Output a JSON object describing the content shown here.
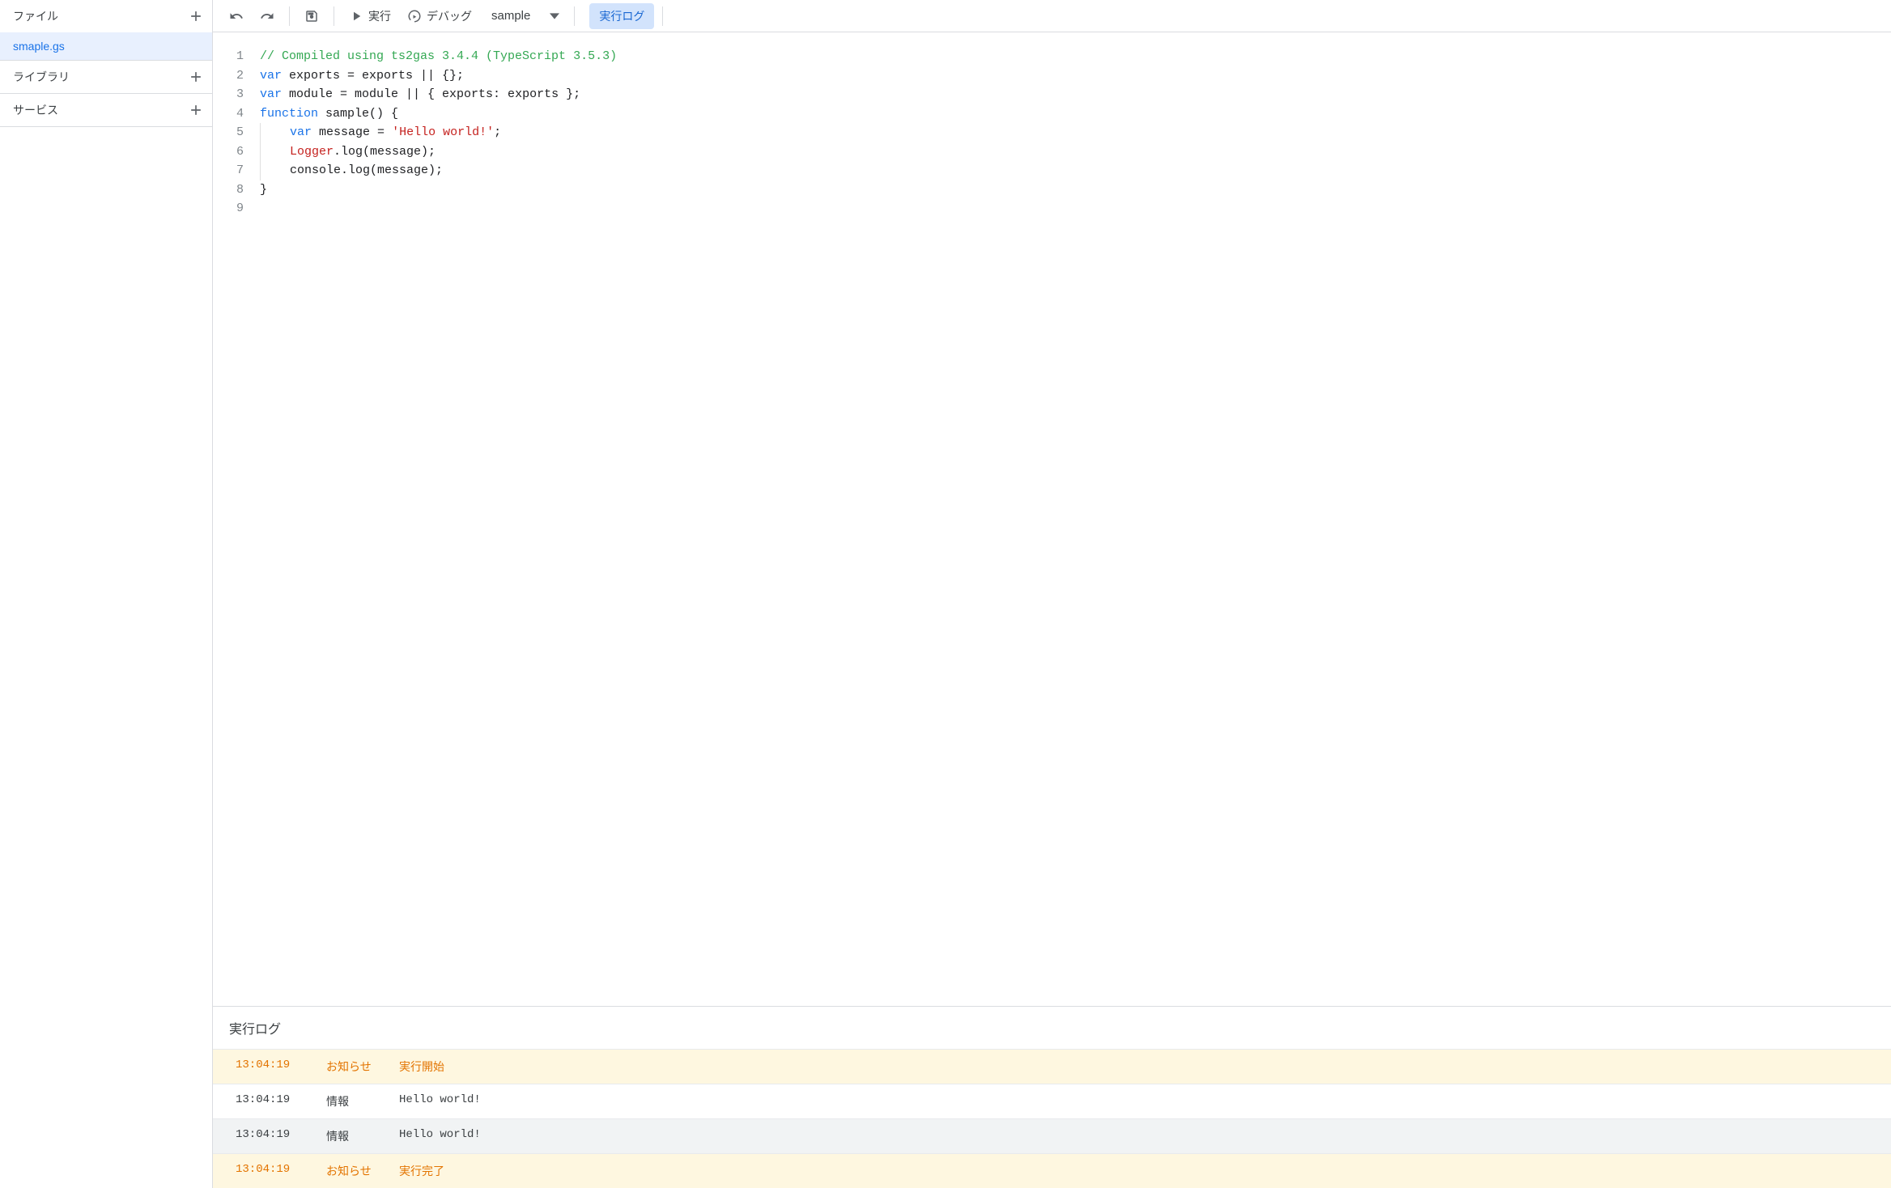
{
  "sidebar": {
    "files_label": "ファイル",
    "libraries_label": "ライブラリ",
    "services_label": "サービス",
    "file_items": [
      {
        "name": "smaple.gs"
      }
    ]
  },
  "toolbar": {
    "run_label": "実行",
    "debug_label": "デバッグ",
    "function_selected": "sample",
    "exec_log_label": "実行ログ"
  },
  "code": {
    "lines": [
      {
        "n": 1,
        "indent": 0,
        "tokens": [
          [
            "comment",
            "// Compiled using ts2gas 3.4.4 (TypeScript 3.5.3)"
          ]
        ]
      },
      {
        "n": 2,
        "indent": 0,
        "tokens": [
          [
            "keyword",
            "var"
          ],
          [
            "default",
            " exports = exports || {};"
          ]
        ]
      },
      {
        "n": 3,
        "indent": 0,
        "tokens": [
          [
            "keyword",
            "var"
          ],
          [
            "default",
            " module = module || { exports: exports };"
          ]
        ]
      },
      {
        "n": 4,
        "indent": 0,
        "tokens": [
          [
            "keyword",
            "function"
          ],
          [
            "default",
            " sample() {"
          ]
        ]
      },
      {
        "n": 5,
        "indent": 1,
        "tokens": [
          [
            "keyword",
            "var"
          ],
          [
            "default",
            " message = "
          ],
          [
            "string",
            "'Hello world!'"
          ],
          [
            "default",
            ";"
          ]
        ]
      },
      {
        "n": 6,
        "indent": 1,
        "tokens": [
          [
            "class",
            "Logger"
          ],
          [
            "default",
            ".log(message);"
          ]
        ]
      },
      {
        "n": 7,
        "indent": 1,
        "tokens": [
          [
            "default",
            "console.log(message);"
          ]
        ]
      },
      {
        "n": 8,
        "indent": 0,
        "tokens": [
          [
            "default",
            "}"
          ]
        ]
      },
      {
        "n": 9,
        "indent": 0,
        "tokens": []
      }
    ]
  },
  "log": {
    "title": "実行ログ",
    "rows": [
      {
        "time": "13:04:19",
        "type": "お知らせ",
        "msg": "実行開始",
        "style": "notice"
      },
      {
        "time": "13:04:19",
        "type": "情報",
        "msg": "Hello world!",
        "style": "normal"
      },
      {
        "time": "13:04:19",
        "type": "情報",
        "msg": "Hello world!",
        "style": "alt"
      },
      {
        "time": "13:04:19",
        "type": "お知らせ",
        "msg": "実行完了",
        "style": "notice"
      }
    ]
  }
}
